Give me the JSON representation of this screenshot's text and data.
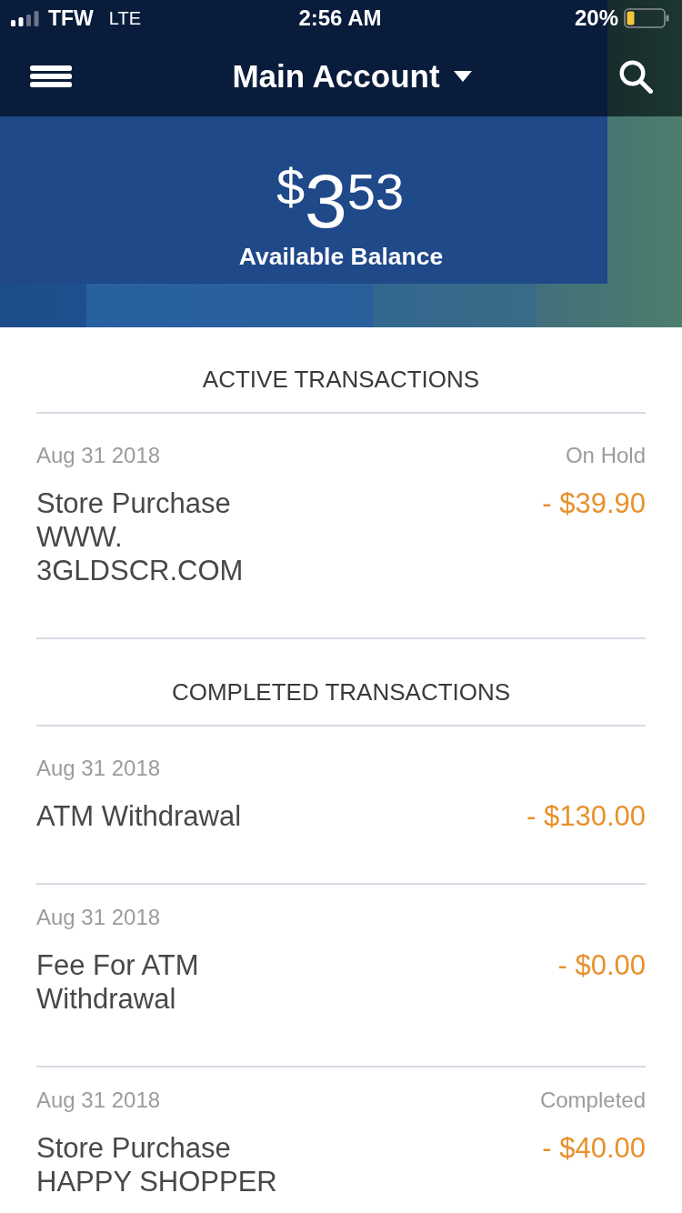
{
  "status_bar": {
    "carrier": "TFW",
    "network": "LTE",
    "time": "2:56 AM",
    "battery": "20%"
  },
  "header": {
    "title": "Main Account"
  },
  "balance": {
    "currency": "$",
    "whole": "3",
    "cents": "53",
    "label": "Available Balance"
  },
  "sections": [
    {
      "title": "ACTIVE TRANSACTIONS",
      "transactions": [
        {
          "date": "Aug 31 2018",
          "status": "On Hold",
          "lines": [
            "Store Purchase",
            "WWW.",
            "3GLDSCR.COM"
          ],
          "amount": "- $39.90"
        }
      ]
    },
    {
      "title": "COMPLETED TRANSACTIONS",
      "transactions": [
        {
          "date": "Aug 31 2018",
          "lines": [
            "ATM Withdrawal"
          ],
          "amount": "- $130.00"
        },
        {
          "date": "Aug 31 2018",
          "lines": [
            "Fee For ATM",
            "Withdrawal"
          ],
          "amount": "- $0.00"
        },
        {
          "date": "Aug 31 2018",
          "status": "Completed",
          "lines": [
            "Store Purchase",
            "HAPPY SHOPPER"
          ],
          "amount": "- $40.00"
        }
      ]
    }
  ]
}
